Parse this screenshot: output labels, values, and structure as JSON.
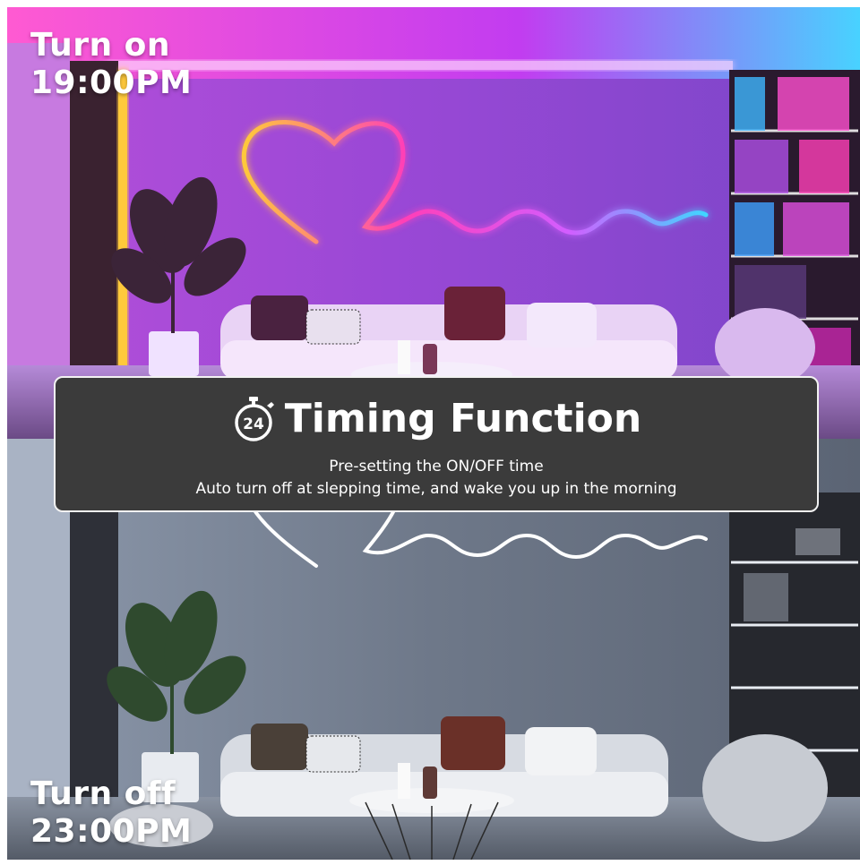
{
  "scenes": {
    "on": {
      "label_line1": "Turn on",
      "label_line2": "19:00PM"
    },
    "off": {
      "label_line1": "Turn off",
      "label_line2": "23:00PM"
    }
  },
  "banner": {
    "icon": "stopwatch-24-icon",
    "icon_text": "24",
    "title": "Timing Function",
    "line1": "Pre-setting the ON/OFF time",
    "line2": "Auto turn off at slepping time, and wake you up in the morning"
  },
  "colors": {
    "room_on": "#8a3ad0",
    "neon_magenta": "#ff2bd8",
    "neon_cyan": "#3fd6ff",
    "neon_yellow": "#ffc93a",
    "room_off": "#6b7585",
    "banner_bg": "#3b3b3b",
    "text": "#ffffff"
  }
}
